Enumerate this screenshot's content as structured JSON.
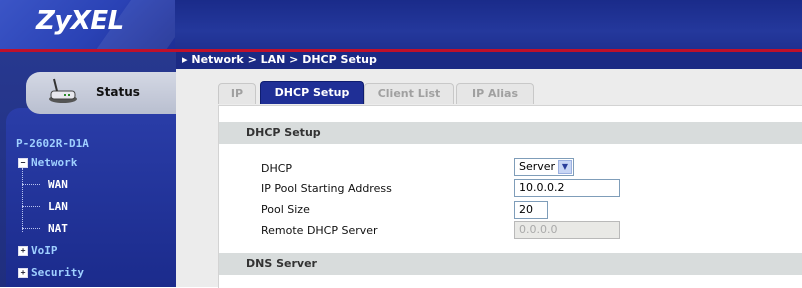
{
  "brand": {
    "logo_text": "ZyXEL"
  },
  "sidebar": {
    "status_label": "Status",
    "device_name": "P-2602R-D1A",
    "items": [
      {
        "label": "Network",
        "expanded": true
      },
      {
        "label": "WAN"
      },
      {
        "label": "LAN"
      },
      {
        "label": "NAT"
      },
      {
        "label": "VoIP",
        "expanded": false
      },
      {
        "label": "Security",
        "expanded": false
      }
    ]
  },
  "breadcrumb": "Network > LAN > DHCP Setup",
  "tabs": [
    {
      "label": "IP",
      "active": false
    },
    {
      "label": "DHCP Setup",
      "active": true
    },
    {
      "label": "Client List",
      "active": false
    },
    {
      "label": "IP Alias",
      "active": false
    }
  ],
  "dhcp_setup": {
    "section_title": "DHCP Setup",
    "dhcp_label": "DHCP",
    "dhcp_value": "Server",
    "ip_pool_label": "IP Pool Starting Address",
    "ip_pool_value": "10.0.0.2",
    "pool_size_label": "Pool Size",
    "pool_size_value": "20",
    "remote_label": "Remote DHCP Server",
    "remote_value": "0.0.0.0"
  },
  "dns_server": {
    "section_title": "DNS Server"
  },
  "colors": {
    "header": "#24389c",
    "accent_red": "#c0102a",
    "tab_active": "#1f2f96"
  }
}
